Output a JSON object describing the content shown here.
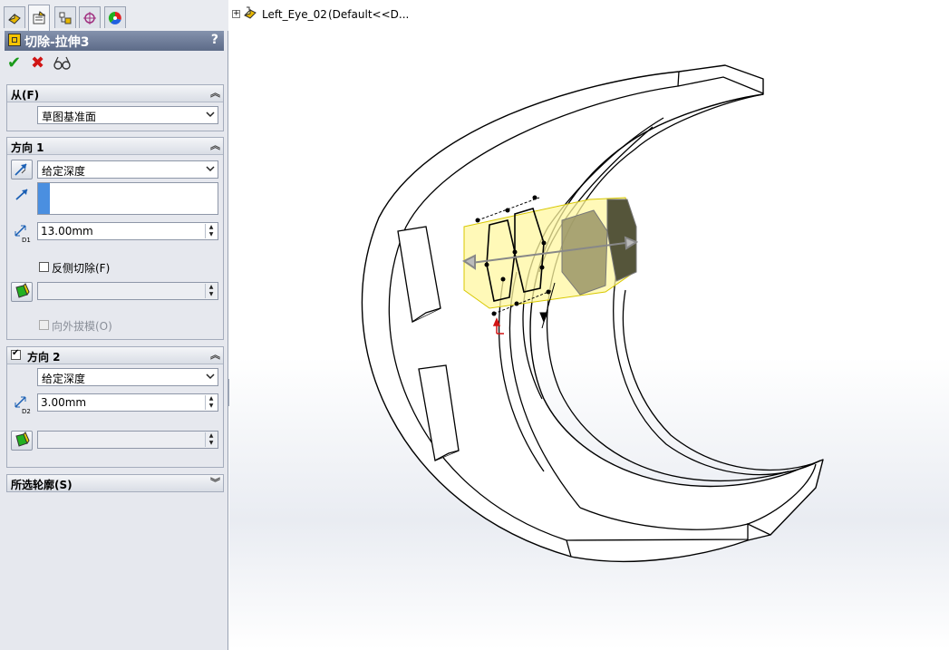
{
  "feature": {
    "title": "切除-拉伸3",
    "help": "?"
  },
  "tabs": [
    "feature-manager",
    "property-manager",
    "configuration-manager",
    "dim-xpert-manager",
    "display-manager"
  ],
  "from": {
    "header": "从(F)",
    "start_condition": "草图基准面"
  },
  "direction1": {
    "header": "方向 1",
    "end_condition": "给定深度",
    "depth": "13.00mm",
    "depth_icon_label": "D1",
    "flip_side_label": "反侧切除(F)",
    "draft_label": "向外拔模(O)"
  },
  "direction2": {
    "header": "方向 2",
    "enabled": true,
    "end_condition": "给定深度",
    "depth": "3.00mm",
    "depth_icon_label": "D2"
  },
  "selected_contours": {
    "header": "所选轮廓(S)"
  },
  "tree": {
    "expand": "+",
    "part_name": "Left_Eye_02",
    "config": "(Default<<D..."
  },
  "colors": {
    "title_bar": "#5d6b88",
    "preview_yellow": "#fff7a0",
    "ok_green": "#1a9a1a",
    "cancel_red": "#d01515"
  }
}
